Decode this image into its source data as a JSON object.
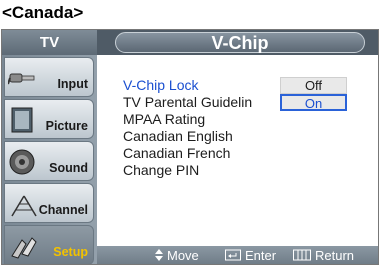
{
  "page_heading": "<Canada>",
  "sidebar": {
    "title": "TV",
    "items": [
      {
        "label": "Input",
        "icon": "input-plug-icon"
      },
      {
        "label": "Picture",
        "icon": "picture-icon"
      },
      {
        "label": "Sound",
        "icon": "speaker-icon"
      },
      {
        "label": "Channel",
        "icon": "antenna-icon"
      },
      {
        "label": "Setup",
        "icon": "setup-icon",
        "active": true
      }
    ]
  },
  "header": {
    "title": "V-Chip"
  },
  "menu": {
    "items": [
      "V-Chip Lock",
      "TV Parental Guidelin",
      "MPAA Rating",
      "Canadian English",
      "Canadian French",
      "Change PIN"
    ],
    "selected_index": 0
  },
  "options": {
    "off": "Off",
    "on": "On",
    "selected": "On"
  },
  "footer": {
    "move": "Move",
    "enter": "Enter",
    "return": "Return"
  },
  "colors": {
    "accent_blue": "#1a4fd0",
    "active_label": "#f2c200",
    "panel_gray": "#6d7a85"
  }
}
